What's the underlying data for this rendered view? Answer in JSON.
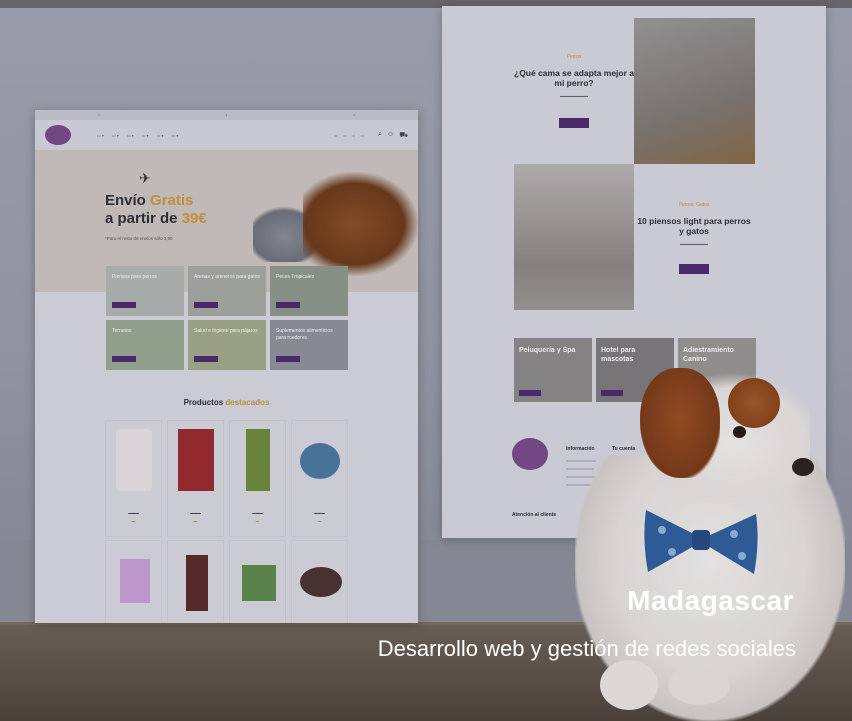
{
  "project": {
    "title": "Madagascar",
    "subtitle": "Desarrollo web y gestión de redes sociales"
  },
  "left_mockup": {
    "hero": {
      "line1_a": "Envío ",
      "line1_b": "Gratis",
      "line2_a": "a partir de ",
      "line2_b": "39€",
      "note": "*Para el resto de envíos sólo 3,90"
    },
    "categories": [
      {
        "label": "Piensos para perros"
      },
      {
        "label": "Arenas y areneros para gatos"
      },
      {
        "label": "Peces Tropicales"
      },
      {
        "label": "Terrarios"
      },
      {
        "label": "Salud e higiene para pájaros"
      },
      {
        "label": "Suplementos alimenticios para roedores"
      }
    ],
    "products_heading_a": "Productos ",
    "products_heading_b": "destacados"
  },
  "right_mockup": {
    "block1": {
      "tag": "Perros",
      "heading": "¿Qué cama se adapta mejor a mi perro?"
    },
    "block2": {
      "tag": "Perros, Gatos",
      "heading": "10 piensos light para perros y gatos"
    },
    "services": [
      {
        "label": "Peluquería y Spa"
      },
      {
        "label": "Hotel para mascotas"
      },
      {
        "label": "Adiestramiento Canino"
      }
    ],
    "footer": {
      "col1": "Información",
      "col2": "Tu cuenta",
      "contact": "Atención al cliente"
    }
  },
  "colors": {
    "accent_gold": "#c99a3a",
    "brand_purple": "#4d2a6e",
    "text_white": "#ffffff"
  }
}
